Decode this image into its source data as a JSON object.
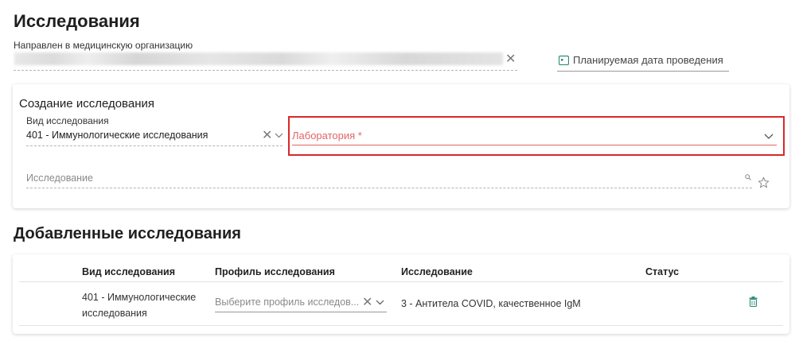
{
  "page": {
    "title": "Исследования",
    "referral_label": "Направлен в медицинскую организацию",
    "planned_date_placeholder": "Планируемая дата проведения"
  },
  "create_section": {
    "title": "Создание исследования",
    "type_label": "Вид исследования",
    "type_value": "401 - Иммунологические исследования",
    "laboratory_placeholder": "Лаборатория *",
    "research_placeholder": "Исследование"
  },
  "added_section": {
    "title": "Добавленные исследования",
    "columns": [
      "Вид исследования",
      "Профиль исследования",
      "Исследование",
      "Статус"
    ],
    "rows": [
      {
        "type_line1": "401 - Иммунологические",
        "type_line2": "исследования",
        "profile_placeholder": "Выберите профиль исследов...",
        "research": "3 - Антитела COVID, качественное IgM",
        "status": ""
      }
    ]
  },
  "colors": {
    "highlight_border": "#d8282a",
    "required_text": "#e06666",
    "accent_icon": "#2e8b7a"
  },
  "icons": [
    "clear-icon",
    "calendar-icon",
    "chevron-down-icon",
    "search-icon",
    "star-icon",
    "trash-icon"
  ]
}
